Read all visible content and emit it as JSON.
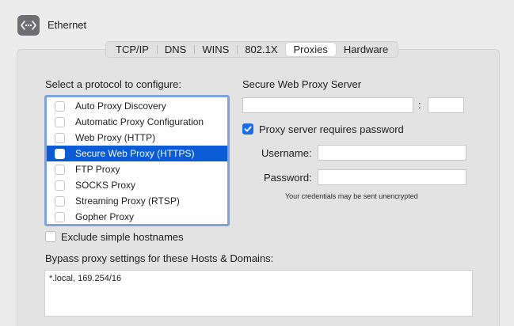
{
  "header": {
    "icon": "ethernet-icon",
    "title": "Ethernet"
  },
  "tabs": [
    {
      "label": "TCP/IP",
      "active": false
    },
    {
      "label": "DNS",
      "active": false
    },
    {
      "label": "WINS",
      "active": false
    },
    {
      "label": "802.1X",
      "active": false
    },
    {
      "label": "Proxies",
      "active": true
    },
    {
      "label": "Hardware",
      "active": false
    }
  ],
  "protocols": {
    "heading": "Select a protocol to configure:",
    "items": [
      {
        "label": "Auto Proxy Discovery",
        "checked": false,
        "selected": false
      },
      {
        "label": "Automatic Proxy Configuration",
        "checked": false,
        "selected": false
      },
      {
        "label": "Web Proxy (HTTP)",
        "checked": false,
        "selected": false
      },
      {
        "label": "Secure Web Proxy (HTTPS)",
        "checked": false,
        "selected": true
      },
      {
        "label": "FTP Proxy",
        "checked": false,
        "selected": false
      },
      {
        "label": "SOCKS Proxy",
        "checked": false,
        "selected": false
      },
      {
        "label": "Streaming Proxy (RTSP)",
        "checked": false,
        "selected": false
      },
      {
        "label": "Gopher Proxy",
        "checked": false,
        "selected": false
      }
    ]
  },
  "exclude_simple": {
    "label": "Exclude simple hostnames",
    "checked": false
  },
  "server": {
    "heading": "Secure Web Proxy Server",
    "host_value": "",
    "separator": ":",
    "port_value": "",
    "requires_password_label": "Proxy server requires password",
    "requires_password_checked": true,
    "username_label": "Username:",
    "username_value": "",
    "password_label": "Password:",
    "password_value": "",
    "credentials_note": "Your credentials may be sent unencrypted"
  },
  "bypass": {
    "label": "Bypass proxy settings for these Hosts & Domains:",
    "value": "*.local, 169.254/16"
  },
  "colors": {
    "selection": "#0b5ad6",
    "list_focus_ring": "#7ea2de",
    "checkbox_checked": "#1a6fe8"
  }
}
